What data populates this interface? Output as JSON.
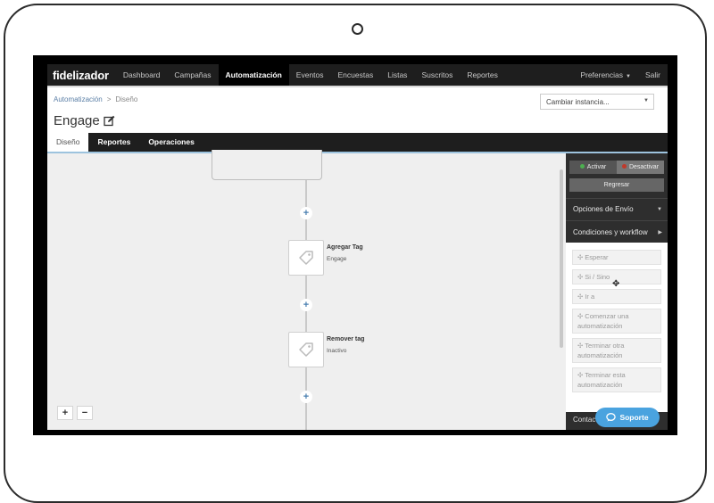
{
  "nav": {
    "brand": "fidelizador",
    "items": [
      {
        "label": "Dashboard",
        "active": false
      },
      {
        "label": "Campañas",
        "active": false
      },
      {
        "label": "Automatización",
        "active": true
      },
      {
        "label": "Eventos",
        "active": false
      },
      {
        "label": "Encuestas",
        "active": false
      },
      {
        "label": "Listas",
        "active": false
      },
      {
        "label": "Suscritos",
        "active": false
      },
      {
        "label": "Reportes",
        "active": false
      }
    ],
    "preferences": "Preferencias",
    "logout": "Salir"
  },
  "breadcrumb": {
    "parent": "Automatización",
    "current": "Diseño",
    "separator": ">"
  },
  "instance_select": {
    "value": "Cambiar instancia..."
  },
  "page_title": "Engage",
  "subtabs": [
    {
      "label": "Diseño",
      "active": true
    },
    {
      "label": "Reportes",
      "active": false
    },
    {
      "label": "Operaciones",
      "active": false
    }
  ],
  "canvas": {
    "plus_symbol": "+",
    "nodes": [
      {
        "title": "Agregar Tag",
        "subtitle": "Engage"
      },
      {
        "title": "Remover tag",
        "subtitle": "Inactivo"
      }
    ],
    "zoom_in": "+",
    "zoom_out": "−"
  },
  "panel": {
    "activate": "Activar",
    "deactivate": "Desactivar",
    "back": "Regresar",
    "sections": [
      "Opciones de Envío",
      "Condiciones y workflow"
    ],
    "tools": [
      "Esperar",
      "Si / Sino",
      "Ir a",
      "Comenzar una automatización",
      "Terminar otra automatización",
      "Terminar esta automatización"
    ],
    "bottom_label": "Contac",
    "colors": {
      "activate_dot": "#4caf50",
      "deactivate_dot": "#c0392b"
    }
  },
  "support": {
    "label": "Soporte",
    "color": "#4aa3df"
  }
}
